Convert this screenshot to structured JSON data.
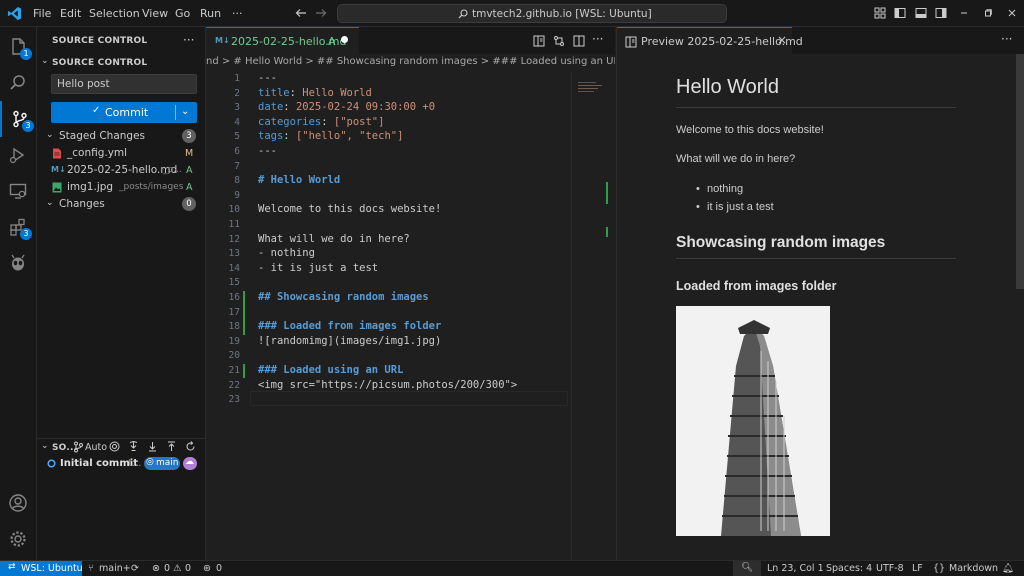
{
  "menu": [
    "File",
    "Edit",
    "Selection",
    "View",
    "Go",
    "Run",
    "···"
  ],
  "search_label": "tmvtech2.github.io [WSL: Ubuntu]",
  "activity_badges": {
    "explorer": "1",
    "scm": "3",
    "extensions": "3"
  },
  "sidebar": {
    "header": "SOURCE CONTROL",
    "section": "SOURCE CONTROL",
    "message": "Hello post",
    "commit_label": "Commit",
    "staged_label": "Staged Changes",
    "staged_count": "3",
    "files": [
      {
        "name": "_config.yml",
        "path": "",
        "status": "M"
      },
      {
        "name": "2025-02-25-hello.md",
        "path": "_p...",
        "status": "A"
      },
      {
        "name": "img1.jpg",
        "path": "_posts/images",
        "status": "A"
      }
    ],
    "changes_label": "Changes",
    "changes_count": "0",
    "graph_header": "SO...",
    "auto_label": "Auto",
    "commit_entry": "Initial commit",
    "commit_entry_suffix": "t...",
    "branch_badge": "main"
  },
  "editor": {
    "tab_label": "2025-02-25-hello.md",
    "tab_status": "A",
    "breadcrumb": "nd > # Hello World > ## Showcasing random images > ### Loaded using an URL",
    "lines": [
      {
        "n": "1",
        "t": "---"
      },
      {
        "n": "2",
        "k": "title",
        "v": " Hello World"
      },
      {
        "n": "3",
        "k": "date",
        "v": " 2025-02-24 09:30:00 +0"
      },
      {
        "n": "4",
        "k": "categories",
        "v": " [\"post\"]"
      },
      {
        "n": "5",
        "k": "tags",
        "v": " [\"hello\", \"tech\"]"
      },
      {
        "n": "6",
        "t": "---"
      },
      {
        "n": "7",
        "t": ""
      },
      {
        "n": "8",
        "h": "# Hello World"
      },
      {
        "n": "9",
        "t": ""
      },
      {
        "n": "10",
        "t": "Welcome to this docs website!"
      },
      {
        "n": "11",
        "t": ""
      },
      {
        "n": "12",
        "t": "What will we do in here?"
      },
      {
        "n": "13",
        "t": "- nothing"
      },
      {
        "n": "14",
        "t": "- it is just a test"
      },
      {
        "n": "15",
        "t": ""
      },
      {
        "n": "16",
        "h": "## Showcasing random images"
      },
      {
        "n": "17",
        "t": ""
      },
      {
        "n": "18",
        "h": "### Loaded from images folder"
      },
      {
        "n": "19",
        "t": "![randomimg](images/img1.jpg)"
      },
      {
        "n": "20",
        "t": ""
      },
      {
        "n": "21",
        "h": "### Loaded using an URL"
      },
      {
        "n": "22",
        "t": "<img src=\"https://picsum.photos/200/300\">"
      },
      {
        "n": "23",
        "t": ""
      }
    ]
  },
  "preview": {
    "tab_label": "Preview 2025-02-25-hello.md",
    "h1": "Hello World",
    "p1": "Welcome to this docs website!",
    "p2": "What will we do in here?",
    "li1": "nothing",
    "li2": "it is just a test",
    "h2": "Showcasing random images",
    "h3": "Loaded from images folder"
  },
  "status": {
    "remote": "WSL: Ubuntu",
    "branch": "main+",
    "problems_errors": "0",
    "problems_warnings": "0",
    "ports": "0",
    "position": "Ln 23, Col 1",
    "spaces": "Spaces: 4",
    "encoding": "UTF-8",
    "eol": "LF",
    "language": "Markdown"
  }
}
